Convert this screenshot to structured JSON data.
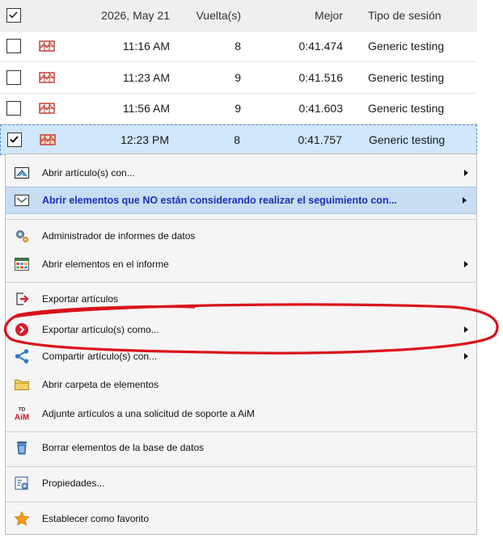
{
  "table": {
    "header": {
      "date": "2026, May 21",
      "laps": "Vuelta(s)",
      "best": "Mejor",
      "session_type": "Tipo de sesión"
    },
    "rows": [
      {
        "time": "11:16 AM",
        "laps": "8",
        "best": "0:41.474",
        "type": "Generic testing",
        "checked": false
      },
      {
        "time": "11:23 AM",
        "laps": "9",
        "best": "0:41.516",
        "type": "Generic testing",
        "checked": false
      },
      {
        "time": "11:56 AM",
        "laps": "9",
        "best": "0:41.603",
        "type": "Generic testing",
        "checked": false
      },
      {
        "time": "12:23 PM",
        "laps": "8",
        "best": "0:41.757",
        "type": "Generic testing",
        "checked": true
      }
    ]
  },
  "menu": {
    "items": [
      {
        "label": "Abrir artículo(s) con...",
        "icon": "chart-open-icon",
        "submenu": true
      },
      {
        "label": "Abrir elementos que NO están considerando realizar el seguimiento con...",
        "icon": "untracked-open-icon",
        "submenu": true
      },
      {
        "label": "Administrador de informes de datos",
        "icon": "gears-icon",
        "submenu": false
      },
      {
        "label": "Abrir elementos en el informe",
        "icon": "report-grid-icon",
        "submenu": true
      },
      {
        "label": "Exportar artículos",
        "icon": "export-icon",
        "submenu": false
      },
      {
        "label": "Exportar artículo(s) como...",
        "icon": "export-as-icon",
        "submenu": true
      },
      {
        "label": "Compartir artículo(s) con...",
        "icon": "share-icon",
        "submenu": true
      },
      {
        "label": "Abrir carpeta de elementos",
        "icon": "folder-icon",
        "submenu": false
      },
      {
        "label": "Adjunte artículos a una solicitud de soporte a AiM",
        "icon": "aim-support-icon",
        "submenu": false
      },
      {
        "label": "Borrar elementos de la base de datos",
        "icon": "trash-icon",
        "submenu": false
      },
      {
        "label": "Propiedades...",
        "icon": "properties-icon",
        "submenu": false
      },
      {
        "label": "Establecer como favorito",
        "icon": "star-icon",
        "submenu": false
      }
    ]
  },
  "icon_labels": {
    "aim_top": "TD",
    "aim_bottom": "AiM"
  },
  "colors": {
    "selected_row": "#cfe6fb",
    "highlight_text": "#1a2fb8",
    "annotation": "#d9141c"
  }
}
